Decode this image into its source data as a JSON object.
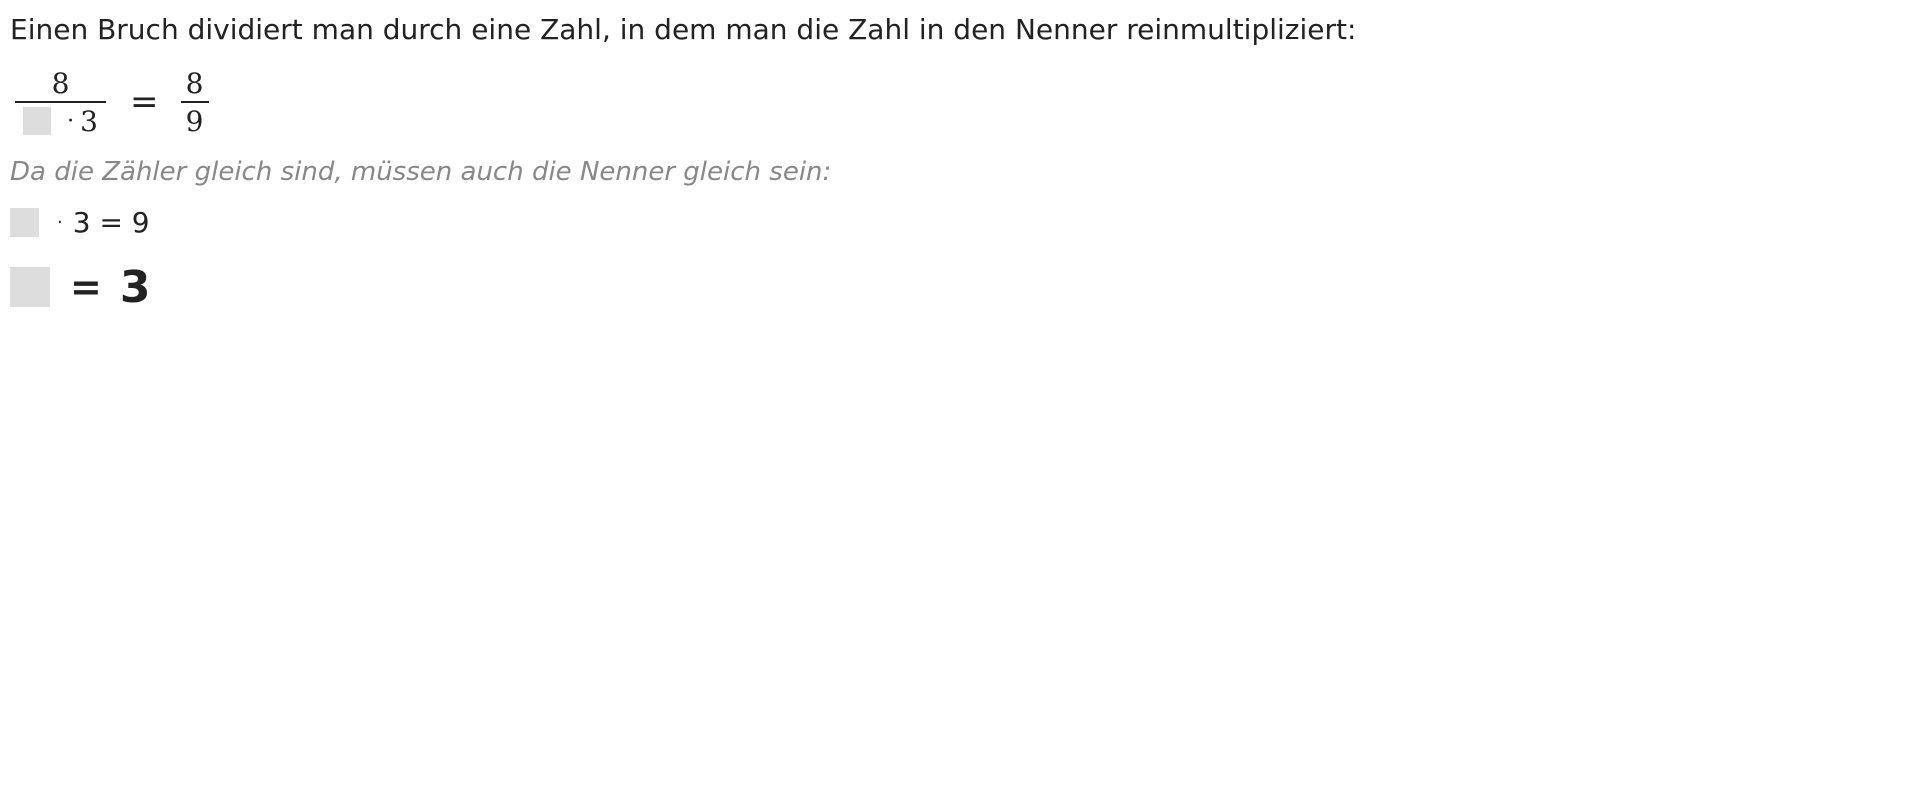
{
  "intro_text": "Einen Bruch dividiert man durch eine Zahl, in dem man die Zahl in den Nenner reinmultipliziert:",
  "fraction_equation": {
    "left_numerator": "8",
    "left_denominator_dot": "·",
    "left_denominator_factor": "3",
    "equals": "=",
    "right_numerator": "8",
    "right_denominator": "9"
  },
  "hint_text": "Da die Zähler gleich sind, müssen auch die Nenner gleich sein:",
  "denominator_equation": {
    "dot": "·",
    "rest": "3 = 9"
  },
  "result_equation": {
    "equals": "=",
    "value": "3"
  },
  "colors": {
    "text": "#222222",
    "hint": "#888888",
    "blank_box": "#dddddd"
  }
}
